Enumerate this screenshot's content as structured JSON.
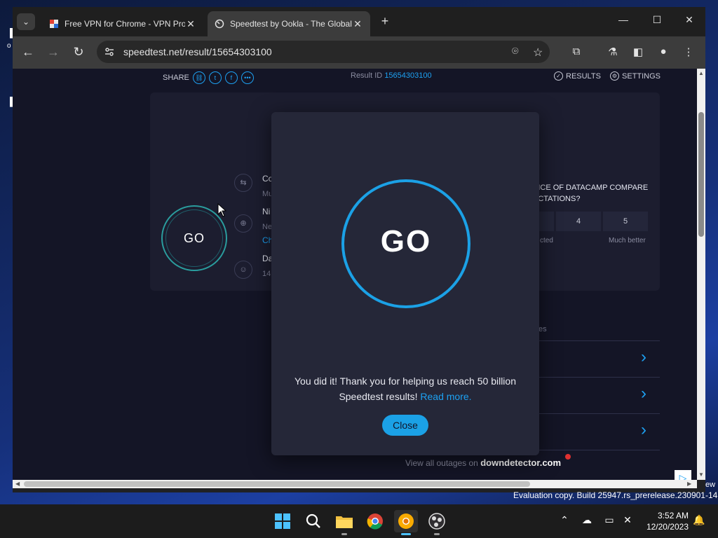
{
  "browser": {
    "tabs": [
      {
        "title": "Free VPN for Chrome - VPN Pro",
        "active": false
      },
      {
        "title": "Speedtest by Ookla - The Global",
        "active": true
      }
    ],
    "url": "speedtest.net/result/15654303100"
  },
  "speedtest": {
    "share_label": "SHARE",
    "result_id_label": "Result ID",
    "result_id": "15654303100",
    "results_link": "RESULTS",
    "settings_link": "SETTINGS",
    "go_small": "GO",
    "info_fragments": {
      "connections": "Co",
      "connections_sub": "Mu",
      "isp": "Ni",
      "isp_sub": "Ne",
      "isp_link": "Ch",
      "host": "Da",
      "host_sub": "14"
    },
    "survey": {
      "question_line1": "VICE OF DATACAMP COMPARE",
      "question_line2": "ECTATIONS?",
      "options": [
        "4",
        "5"
      ],
      "label_left": "cted",
      "label_right": "Much better"
    },
    "outages_fragment": "es",
    "downdetector_prefix": "View all outages on",
    "downdetector_brand": "downdetector.com"
  },
  "modal": {
    "go_label": "GO",
    "message": "You did it! Thank you for helping us reach 50 billion Speedtest results!",
    "link_text": "Read more.",
    "close_button": "Close"
  },
  "desktop": {
    "eval_text": "Evaluation copy. Build 25947.rs_prerelease.230901-1416",
    "edge_fragment": "ew"
  },
  "taskbar": {
    "time": "3:52 AM",
    "date": "12/20/2023"
  },
  "colors": {
    "accent": "#1da1f2",
    "page_bg": "#141526",
    "modal_bg": "#252738"
  }
}
